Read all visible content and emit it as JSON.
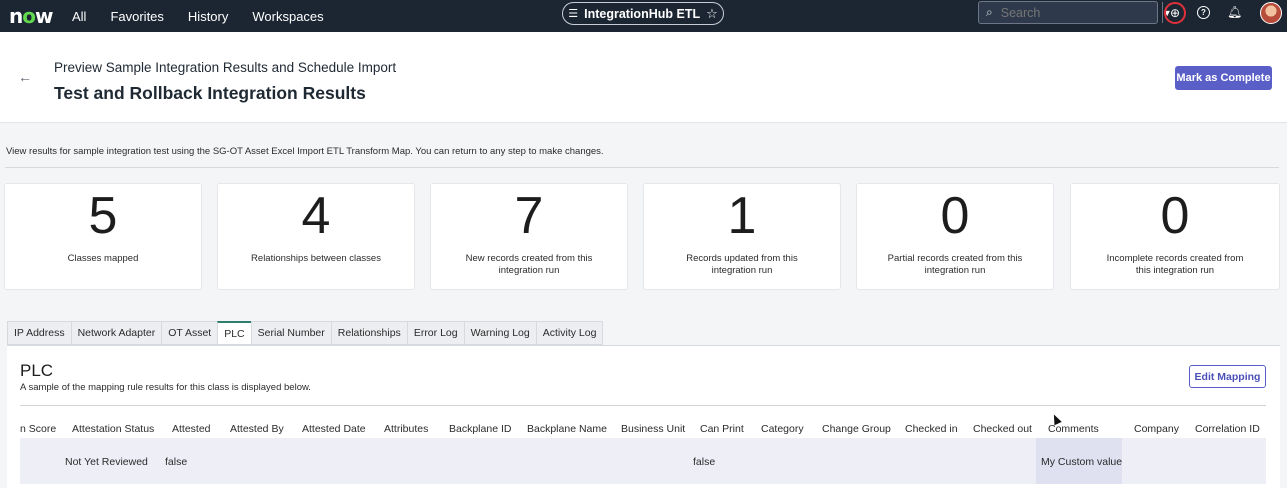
{
  "nav": {
    "logo": "now",
    "links": [
      "All",
      "Favorites",
      "History",
      "Workspaces"
    ],
    "app_pill": "IntegrationHub ETL",
    "search_placeholder": "Search"
  },
  "header": {
    "subtitle": "Preview Sample Integration Results and Schedule Import",
    "title": "Test and Rollback Integration Results",
    "complete_button": "Mark as Complete"
  },
  "description": "View results for sample integration test using the SG-OT Asset Excel Import ETL Transform Map. You can return to any step to make changes.",
  "cards": [
    {
      "value": "5",
      "label": "Classes mapped"
    },
    {
      "value": "4",
      "label": "Relationships between classes"
    },
    {
      "value": "7",
      "label": "New records created from this integration run"
    },
    {
      "value": "1",
      "label": "Records updated from this integration run"
    },
    {
      "value": "0",
      "label": "Partial records created from this integration run"
    },
    {
      "value": "0",
      "label": "Incomplete records created from this integration run"
    }
  ],
  "tabs": [
    "IP Address",
    "Network Adapter",
    "OT Asset",
    "PLC",
    "Serial Number",
    "Relationships",
    "Error Log",
    "Warning Log",
    "Activity Log"
  ],
  "active_tab": "PLC",
  "section": {
    "title": "PLC",
    "subtitle": "A sample of the mapping rule results for this class is displayed below.",
    "edit_button": "Edit Mapping"
  },
  "table": {
    "columns": [
      "n Score",
      "Attestation Status",
      "Attested",
      "Attested By",
      "Attested Date",
      "Attributes",
      "Backplane ID",
      "Backplane Name",
      "Business Unit",
      "Can Print",
      "Category",
      "Change Group",
      "Checked in",
      "Checked out",
      "Comments",
      "Company",
      "Correlation ID"
    ],
    "row": [
      "",
      "Not Yet Reviewed",
      "false",
      "",
      "",
      "",
      "",
      "",
      "",
      "false",
      "",
      "",
      "",
      "",
      "My Custom value",
      "",
      ""
    ]
  }
}
